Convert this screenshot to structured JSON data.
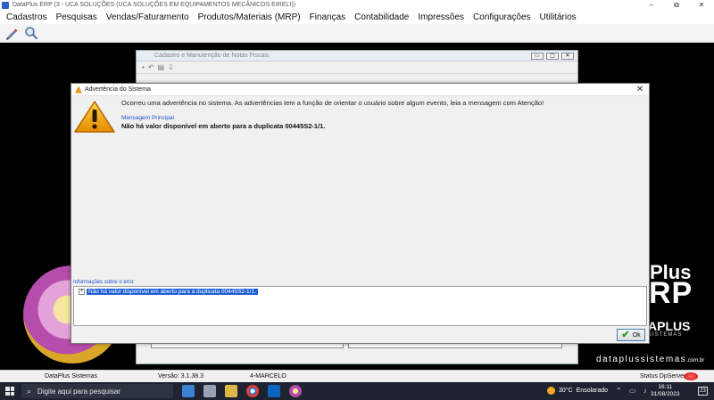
{
  "window": {
    "title": "DataPlus ERP (3 - UCA SOLUÇÕES (UCA SOLUÇÕES EM EQUIPAMENTOS MECÂNICOS EIRELI))",
    "minimize": "–",
    "maximize": "⧉",
    "close": "✕"
  },
  "menu": {
    "items": [
      "Cadastros",
      "Pesquisas",
      "Vendas/Faturamento",
      "Produtos/Materiais (MRP)",
      "Finanças",
      "Contabilidade",
      "Impressões",
      "Configurações",
      "Utilitários"
    ]
  },
  "toolbar": {
    "icons": [
      "pen-icon",
      "magnifier-icon"
    ]
  },
  "background_window": {
    "title": "Cadastro e Manutenção de Notas Fiscais"
  },
  "branding": {
    "plus": "Plus",
    "rp": "RP",
    "aplus": "APLUS",
    "sistemas": "SISTEMAS",
    "url": "dataplussistemas",
    "url_suffix": ".com.br"
  },
  "dialog": {
    "title": "Advertência do Sistema",
    "close": "✕",
    "intro": "Ocorreu uma advertência no sistema. As advertências tem a função de orientar o usuário sobre algum evento, leia a mensagem com Atenção!",
    "message_label": "Mensagem Principal",
    "message": "Não há valor disponível em aberto para a duplicata 00445S2-1/1.",
    "error_info_label": "Informações sobre o erro:",
    "error_expand": "+",
    "error_item": "Não há valor disponível em aberto para a duplicata 00445S2-1/1.",
    "ok_label": "Ok"
  },
  "statusbar": {
    "company": "DataPlus Sistemas",
    "version": "Versão: 3.1.38.3",
    "user": "4-MARCELO",
    "server_status": "Status DpServer"
  },
  "taskbar": {
    "search_placeholder": "Digite aqui para pesquisar",
    "weather_temp": "30°C",
    "weather_desc": "Ensolarado",
    "time": "16:11",
    "date": "31/08/2023",
    "notifications": "23"
  },
  "colors": {
    "accent_blue": "#1f5fd6",
    "label_blue": "#1f4fd1",
    "warning_orange": "#e39a1e",
    "taskbar": "#1f2330"
  }
}
